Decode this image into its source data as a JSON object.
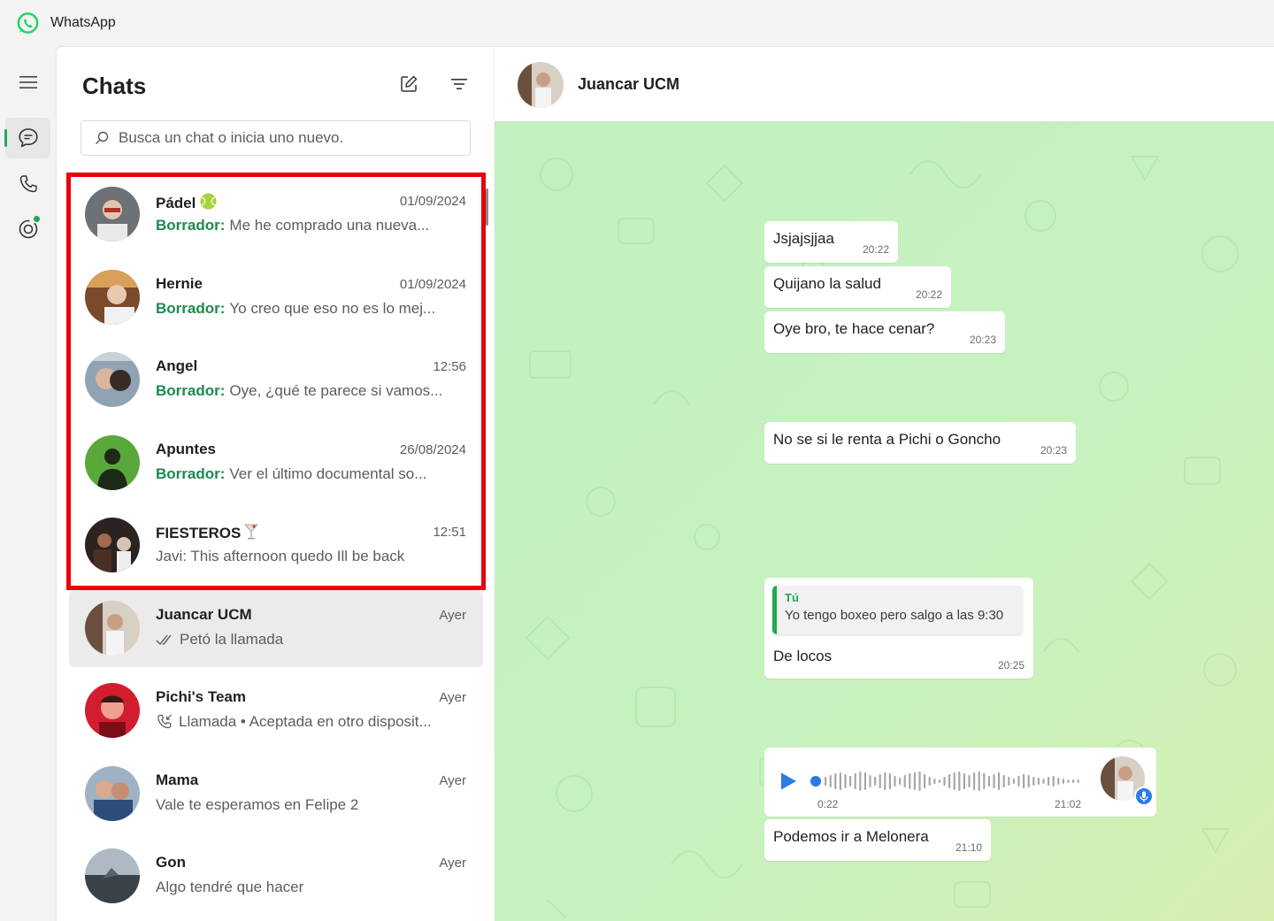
{
  "app": {
    "title": "WhatsApp",
    "brand_color": "#25D366",
    "accent_color": "#1d8a4e"
  },
  "rail": {
    "items": [
      {
        "name": "menu",
        "icon": "hamburger-menu-icon"
      },
      {
        "name": "chats",
        "icon": "chat-bubble-icon",
        "active": true
      },
      {
        "name": "calls",
        "icon": "phone-icon"
      },
      {
        "name": "status",
        "icon": "status-ring-icon",
        "has_unread_dot": true
      }
    ]
  },
  "chatlist": {
    "title": "Chats",
    "new_chat_icon": "new-chat-icon",
    "filter_icon": "filter-icon",
    "search": {
      "placeholder": "Busca un chat o inicia uno nuevo.",
      "value": ""
    },
    "draft_label": "Borrador:",
    "chats": [
      {
        "name": "Pádel",
        "name_emoji": "tennis-ball",
        "time": "01/09/2024",
        "draft": true,
        "preview": "Me he comprado una nueva..."
      },
      {
        "name": "Hernie",
        "time": "01/09/2024",
        "draft": true,
        "preview": "Yo creo que eso no es lo mej..."
      },
      {
        "name": "Angel",
        "time": "12:56",
        "draft": true,
        "preview": "Oye, ¿qué te parece si vamos..."
      },
      {
        "name": "Apuntes",
        "time": "26/08/2024",
        "draft": true,
        "preview": "Ver el último documental so..."
      },
      {
        "name": "FIESTEROS",
        "name_emoji": "cocktail-glass",
        "time": "12:51",
        "draft": false,
        "preview": "Javi: This afternoon quedo Ill be back"
      },
      {
        "name": "Juancar UCM",
        "time": "Ayer",
        "draft": false,
        "selected": true,
        "preview_icon": "double-check-icon",
        "preview": "Petó la llamada"
      },
      {
        "name": "Pichi's Team",
        "time": "Ayer",
        "draft": false,
        "preview_icon": "incoming-call-icon",
        "preview": "Llamada • Aceptada en otro disposit..."
      },
      {
        "name": "Mama",
        "time": "Ayer",
        "draft": false,
        "preview": "Vale te esperamos en Felipe 2"
      },
      {
        "name": "Gon",
        "time": "Ayer",
        "draft": false,
        "preview": "Algo tendré que hacer"
      }
    ]
  },
  "conversation": {
    "contact_name": "Juancar UCM",
    "messages": [
      {
        "text": "Jsjajsjjaa",
        "time": "20:22"
      },
      {
        "text": "Quijano la salud",
        "time": "20:22"
      },
      {
        "text": "Oye bro, te hace cenar?",
        "time": "20:23"
      },
      {
        "text": "No se si le renta a Pichi o Goncho",
        "time": "20:23"
      },
      {
        "quote_author": "Tú",
        "quote_text": "Yo tengo boxeo pero salgo a las 9:30",
        "text": "De locos",
        "time": "20:25"
      },
      {
        "type": "voice",
        "elapsed": "0:22",
        "time": "21:02",
        "played_fraction": 0.0
      },
      {
        "text": "Podemos ir a Melonera",
        "time": "21:10"
      }
    ]
  }
}
